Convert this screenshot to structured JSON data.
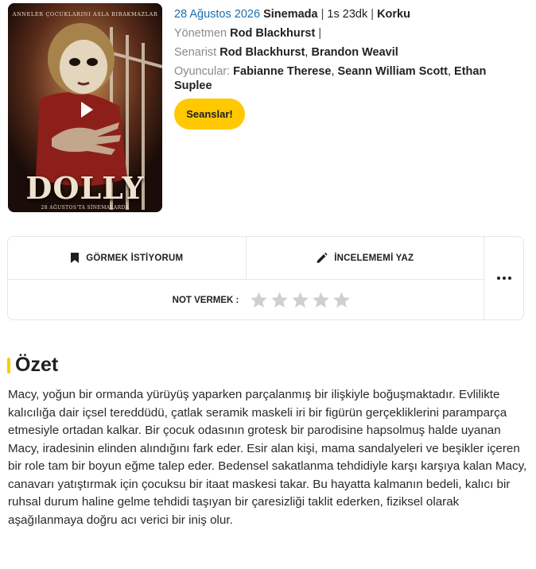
{
  "poster": {
    "tagline": "ANNELER ÇOCUKLARINI ASLA BIRAKMAZLAR",
    "title": "DOLLY",
    "release_text": "28 AĞUSTOS'TA SİNEMALARDA"
  },
  "movie": {
    "release_date": "28 Ağustos 2026",
    "status": "Sinemada",
    "duration": "1s 23dk",
    "genre": "Korku",
    "director_label": "Yönetmen",
    "director": "Rod Blackhurst",
    "writer_label": "Senarist",
    "writers": [
      "Rod Blackhurst",
      "Brandon Weavil"
    ],
    "cast_label": "Oyuncular:",
    "cast": [
      "Fabianne Therese",
      "Seann William Scott",
      "Ethan Suplee"
    ]
  },
  "sessions_label": "Seanslar!",
  "actions": {
    "watchlist_label": "GÖRMEK İSTİYORUM",
    "review_label": "İNCELEMEMİ YAZ",
    "rating_label": "NOT VERMEK :"
  },
  "rating": {
    "max": 5,
    "value": 0
  },
  "summary": {
    "title": "Özet",
    "text": "Macy, yoğun bir ormanda yürüyüş yaparken parçalanmış bir ilişkiyle boğuşmaktadır. Evlilikte kalıcılığa dair içsel tereddüdü, çatlak seramik maskeli iri bir figürün gerçekliklerini paramparça etmesiyle ortadan kalkar. Bir çocuk odasının grotesk bir parodisine hapsolmuş halde uyanan Macy, iradesinin elinden alındığını fark eder. Esir alan kişi, mama sandalyeleri ve beşikler içeren bir role tam bir boyun eğme talep eder. Bedensel sakatlanma tehdidiyle karşı karşıya kalan Macy, canavarı yatıştırmak için çocuksu bir itaat maskesi takar. Bu hayatta kalmanın bedeli, kalıcı bir ruhsal durum haline gelme tehdidi taşıyan bir çaresizliği taklit ederken, fiziksel olarak aşağılanmaya doğru acı verici bir iniş olur."
  },
  "colors": {
    "accent": "#ffc800",
    "link": "#1a6fb0",
    "star_empty": "#cfcfcf"
  },
  "icons": [
    "bookmark-icon",
    "pencil-icon",
    "star-icon",
    "more-icon",
    "play-icon"
  ]
}
